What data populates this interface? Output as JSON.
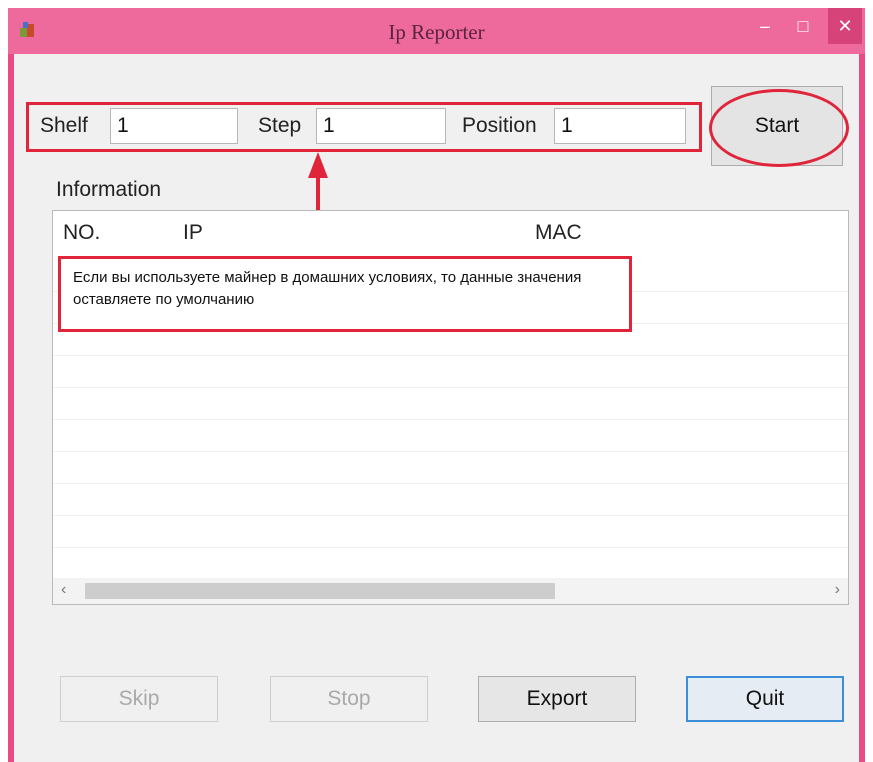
{
  "window": {
    "title": "Ip Reporter"
  },
  "fields": {
    "shelf_label": "Shelf",
    "shelf_value": "1",
    "step_label": "Step",
    "step_value": "1",
    "position_label": "Position",
    "position_value": "1"
  },
  "start_label": "Start",
  "information_label": "Information",
  "list": {
    "columns": [
      "NO.",
      "IP",
      "MAC"
    ]
  },
  "annotation": "Если вы используете майнер в домашних условиях, то данные значения оставляете по умолчанию",
  "buttons": {
    "skip": "Skip",
    "stop": "Stop",
    "export": "Export",
    "quit": "Quit"
  },
  "colors": {
    "titlebar": "#ee6a9d",
    "annotation_red": "#e0253b",
    "focus_blue": "#3c8ed8"
  }
}
